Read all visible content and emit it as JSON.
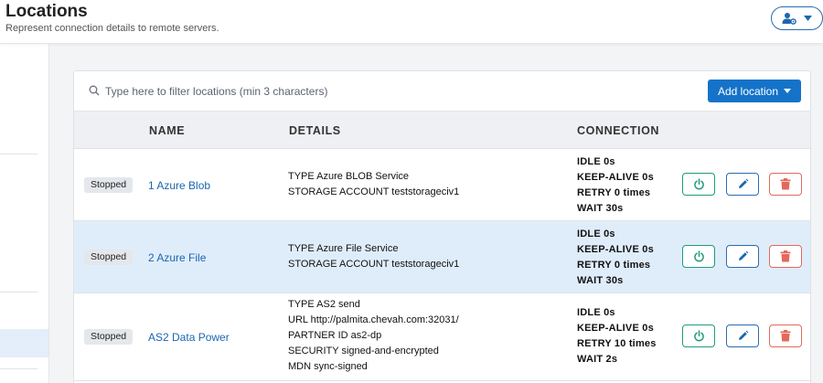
{
  "header": {
    "title": "Locations",
    "subtitle": "Represent connection details to remote servers."
  },
  "search": {
    "placeholder": "Type here to filter locations (min 3 characters)"
  },
  "toolbar": {
    "add_label": "Add location"
  },
  "table": {
    "columns": [
      "NAME",
      "DETAILS",
      "CONNECTION"
    ],
    "rows": [
      {
        "status": "Stopped",
        "name": "1 Azure Blob",
        "details": [
          "TYPE Azure BLOB Service",
          "STORAGE ACCOUNT teststorageciv1"
        ],
        "connection": [
          "IDLE 0s",
          "KEEP-ALIVE 0s",
          "RETRY 0 times",
          "WAIT 30s"
        ]
      },
      {
        "status": "Stopped",
        "name": "2 Azure File",
        "details": [
          "TYPE Azure File Service",
          "STORAGE ACCOUNT teststorageciv1"
        ],
        "connection": [
          "IDLE 0s",
          "KEEP-ALIVE 0s",
          "RETRY 0 times",
          "WAIT 30s"
        ]
      },
      {
        "status": "Stopped",
        "name": "AS2 Data Power",
        "details": [
          "TYPE AS2 send",
          "URL http://palmita.chevah.com:32031/",
          "PARTNER ID as2-dp",
          "SECURITY signed-and-encrypted",
          "MDN sync-signed"
        ],
        "connection": [
          "IDLE 0s",
          "KEEP-ALIVE 0s",
          "RETRY 10 times",
          "WAIT 2s"
        ]
      }
    ]
  },
  "icons": {
    "user_menu": "user-gear-icon",
    "search": "search-icon",
    "power": "power-icon",
    "edit": "pencil-icon",
    "delete": "trash-icon"
  },
  "colors": {
    "accent": "#1473c9",
    "link": "#1a66b0",
    "power": "#1f9c7b",
    "delete": "#e4695b",
    "row_highlight": "#dfedfa"
  }
}
